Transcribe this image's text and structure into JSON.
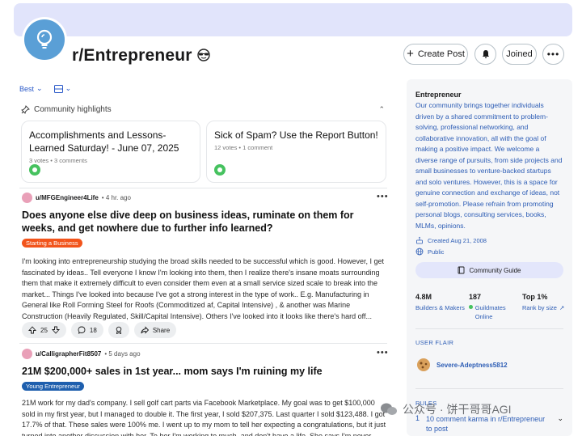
{
  "subreddit": {
    "name": "r/Entrepreneur",
    "create_post_label": "Create Post",
    "joined_label": "Joined"
  },
  "sort": {
    "mode": "Best"
  },
  "highlights": {
    "heading": "Community highlights",
    "cards": [
      {
        "title": "Accomplishments and Lessons-Learned Saturday! - June 07, 2025",
        "meta": "3 votes • 3 comments"
      },
      {
        "title": "Sick of Spam? Use the Report Button!",
        "meta": "12 votes • 1 comment"
      }
    ]
  },
  "posts": [
    {
      "author": "u/MFGEngineer4Life",
      "time": "• 4 hr. ago",
      "title": "Does anyone else dive deep on business ideas, ruminate on them for weeks, and get nowhere due to further info learned?",
      "flair": "Starting a Business",
      "body": "I'm looking into entrepreneurship studying the broad skills needed to be successful which is good. However, I get fascinated by ideas.. Tell everyone I know I'm looking into them, then I realize there's insane moats surrounding them that make it extremely difficult to even consider them even at a small service sized scale to break into the market... Things I've looked into because I've got a strong interest in the type of work.. E.g. Manufacturing in General like Roll Forming Steel for Roofs (Commoditized af, Capital Intensive) , & another was Marine Construction (Heavily Regulated, Skill/Capital Intensive). Others I've looked into it looks like there's hard off...",
      "votes": "25",
      "comments": "18",
      "share_label": "Share"
    },
    {
      "author": "u/CalligrapherFit8507",
      "time": "• 5 days ago",
      "title": "21M $200,000+ sales in 1st year... mom says I'm ruining my life",
      "flair": "Young Entrepreneur",
      "body": "21M work for my dad's company. I sell golf cart parts via Facebook Marketplace. My goal was to get $100,000 sold in my first year, but I managed to double it. The first year, I sold $207,375. Last quarter I sold $123,488. I got 17.7% of that. These sales were 100% me. I went up to my mom to tell her expecting a congratulations, but it just turned into another discussion with her. To her I'm working to much, and don't have a life. She says I'm never..."
    }
  ],
  "sidebar": {
    "title": "Entrepreneur",
    "description": "Our community brings together individuals driven by a shared commitment to problem-solving, professional networking, and collaborative innovation, all with the goal of making a positive impact. We welcome a diverse range of pursuits, from side projects and small businesses to venture-backed startups and solo ventures. However, this is a space for genuine connection and exchange of ideas, not self-promotion. Please refrain from promoting personal blogs, consulting services, books, MLMs, opinions.",
    "created": "Created Aug 21, 2008",
    "visibility": "Public",
    "guide_label": "Community Guide",
    "stats": [
      {
        "value": "4.8M",
        "label": "Builders & Makers"
      },
      {
        "value": "187",
        "label": "Guildmates Online"
      },
      {
        "value": "Top 1%",
        "label": "Rank by size"
      }
    ],
    "user_flair_heading": "USER FLAIR",
    "user_flair": "Severe-Adeptness5812",
    "rules_heading": "RULES",
    "rule_1_number": "1",
    "rule_1_text": "10 comment karma in r/Entrepreneur to post"
  },
  "watermark": "公众号 · 饼干哥哥AGI"
}
